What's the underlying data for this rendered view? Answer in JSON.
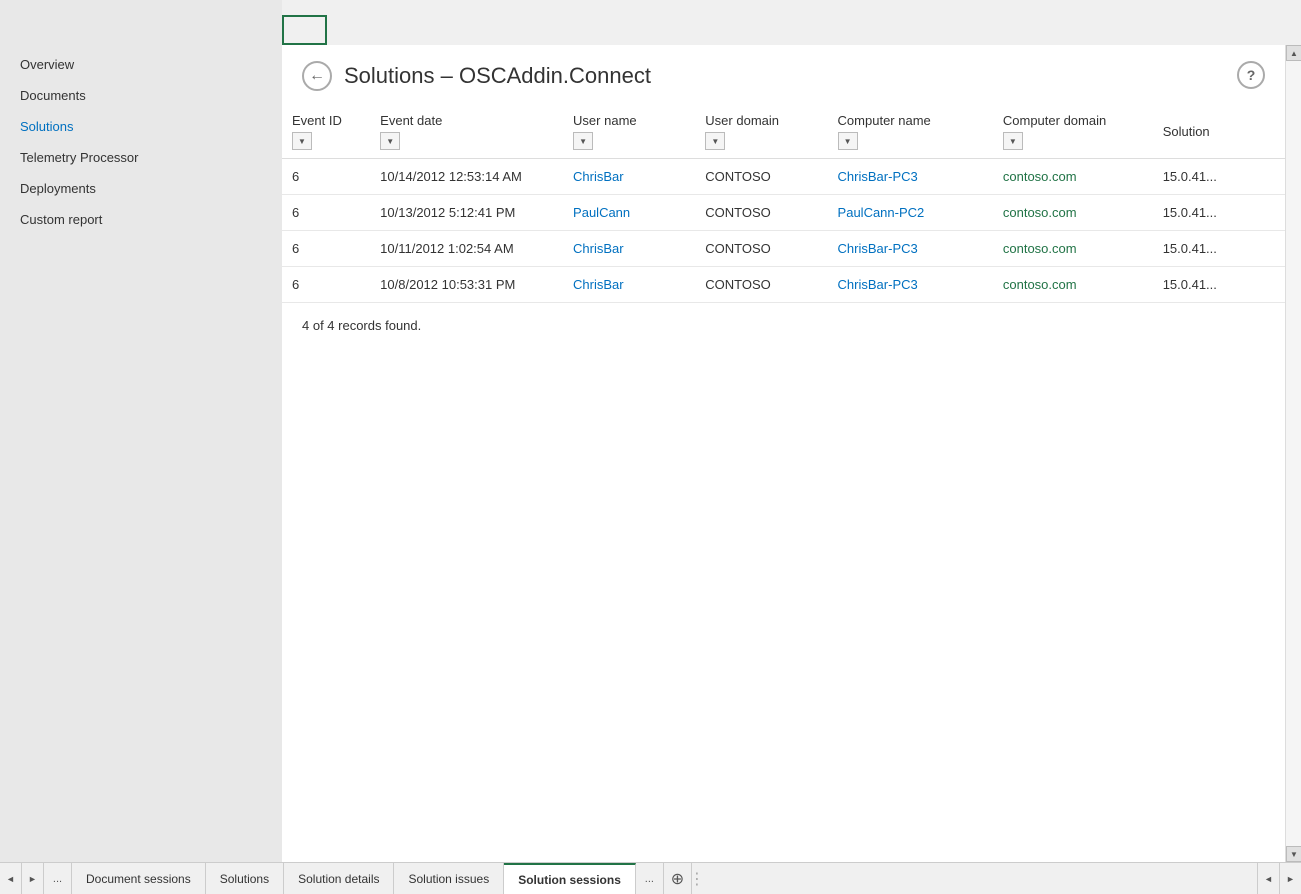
{
  "sidebar": {
    "items": [
      {
        "id": "overview",
        "label": "Overview",
        "active": false
      },
      {
        "id": "documents",
        "label": "Documents",
        "active": false
      },
      {
        "id": "solutions",
        "label": "Solutions",
        "active": true
      },
      {
        "id": "telemetry-processor",
        "label": "Telemetry Processor",
        "active": false
      },
      {
        "id": "deployments",
        "label": "Deployments",
        "active": false
      },
      {
        "id": "custom-report",
        "label": "Custom report",
        "active": false
      }
    ]
  },
  "header": {
    "title": "Solutions – OSCAddin.Connect",
    "back_label": "←",
    "help_label": "?"
  },
  "table": {
    "columns": [
      {
        "id": "event-id",
        "label": "Event ID"
      },
      {
        "id": "event-date",
        "label": "Event date"
      },
      {
        "id": "user-name",
        "label": "User name"
      },
      {
        "id": "user-domain",
        "label": "User domain"
      },
      {
        "id": "computer-name",
        "label": "Computer name"
      },
      {
        "id": "computer-domain",
        "label": "Computer domain"
      },
      {
        "id": "solution",
        "label": "Solution"
      }
    ],
    "rows": [
      {
        "event_id": "6",
        "event_date": "10/14/2012 12:53:14 AM",
        "user_name": "ChrisBar",
        "user_domain": "CONTOSO",
        "computer_name": "ChrisBar-PC3",
        "computer_domain": "contoso.com",
        "solution": "15.0.41..."
      },
      {
        "event_id": "6",
        "event_date": "10/13/2012 5:12:41 PM",
        "user_name": "PaulCann",
        "user_domain": "CONTOSO",
        "computer_name": "PaulCann-PC2",
        "computer_domain": "contoso.com",
        "solution": "15.0.41..."
      },
      {
        "event_id": "6",
        "event_date": "10/11/2012 1:02:54 AM",
        "user_name": "ChrisBar",
        "user_domain": "CONTOSO",
        "computer_name": "ChrisBar-PC3",
        "computer_domain": "contoso.com",
        "solution": "15.0.41..."
      },
      {
        "event_id": "6",
        "event_date": "10/8/2012 10:53:31 PM",
        "user_name": "ChrisBar",
        "user_domain": "CONTOSO",
        "computer_name": "ChrisBar-PC3",
        "computer_domain": "contoso.com",
        "solution": "15.0.41..."
      }
    ],
    "records_found": "4 of 4 records found."
  },
  "bottom_tabs": [
    {
      "id": "document-sessions",
      "label": "Document sessions",
      "active": false
    },
    {
      "id": "solutions",
      "label": "Solutions",
      "active": false
    },
    {
      "id": "solution-details",
      "label": "Solution details",
      "active": false
    },
    {
      "id": "solution-issues",
      "label": "Solution issues",
      "active": false
    },
    {
      "id": "solution-sessions",
      "label": "Solution sessions",
      "active": true
    }
  ],
  "nav": {
    "prev_label": "◄",
    "next_label": "►",
    "overflow_label": "...",
    "add_label": "⊕",
    "separator_label": "⋮"
  }
}
